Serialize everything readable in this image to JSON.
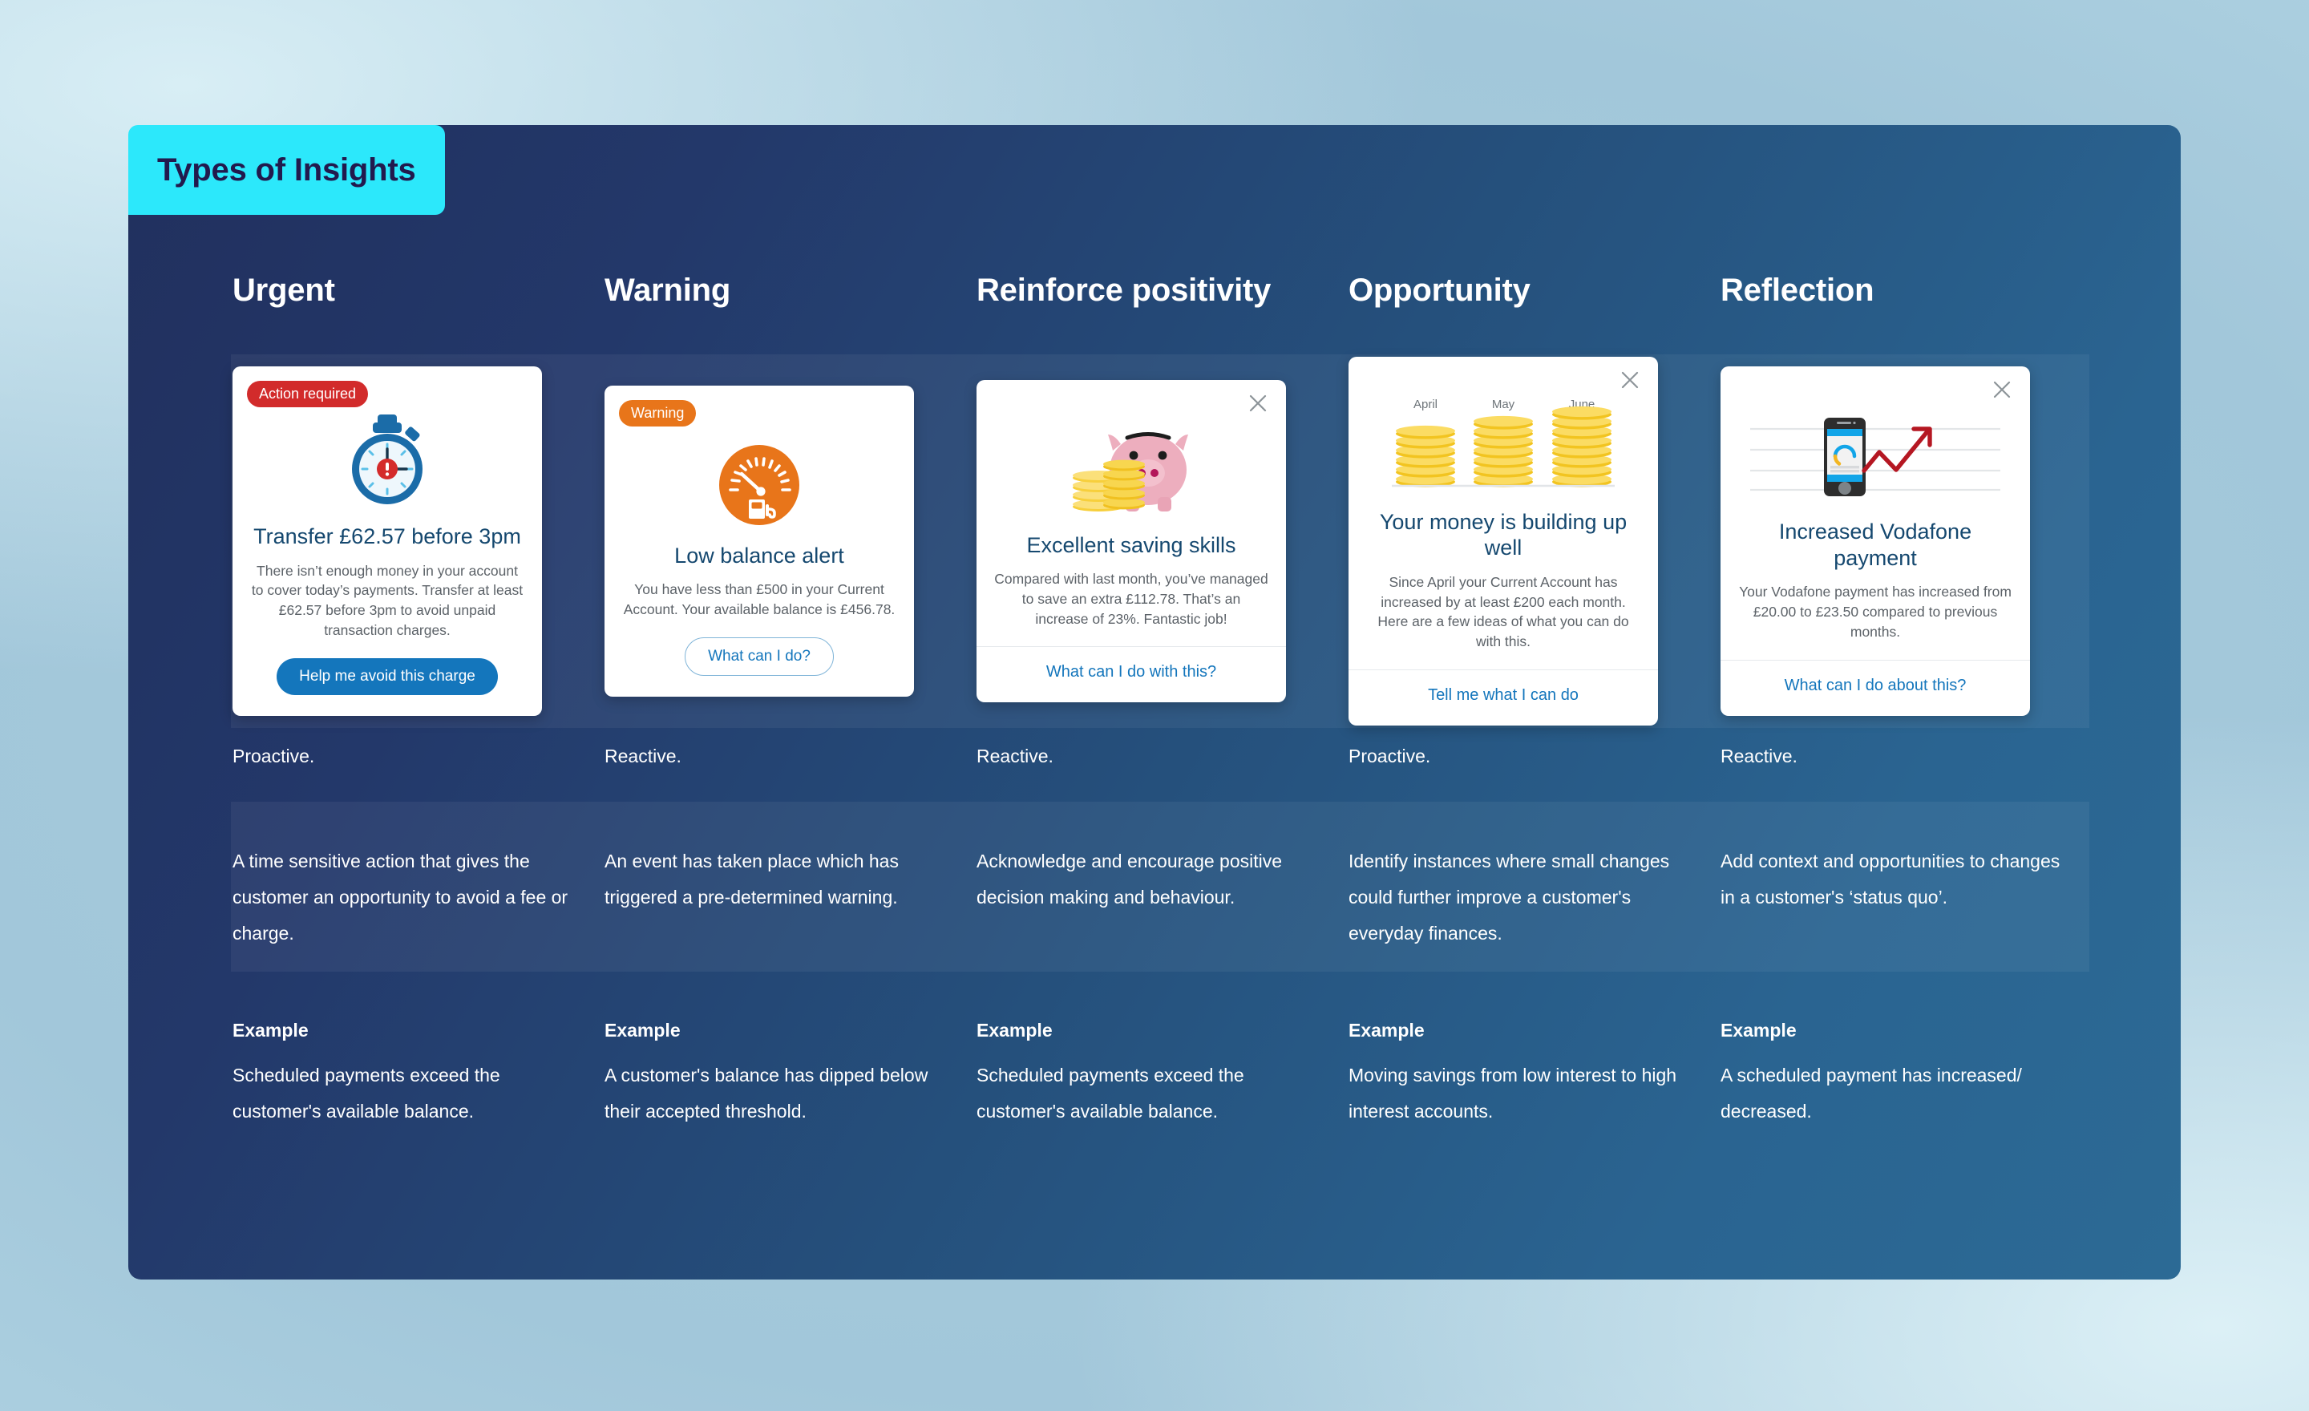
{
  "title_tab": {
    "label": "Types of Insights"
  },
  "theme": {
    "tab_bg": "#2ce8fb",
    "tab_text": "#221a4d",
    "panel_from": "#21305e",
    "panel_to": "#2c6a95",
    "badge_red": "#d22b2b",
    "badge_orange": "#e8751a",
    "link_blue": "#1476bc",
    "card_title": "#15486f"
  },
  "columns": [
    {
      "header": "Urgent",
      "mode": "Proactive.",
      "description": "A time sensitive action that gives the customer an opportunity to avoid a fee or charge.",
      "example_label": "Example",
      "example": "Scheduled payments exceed the customer's available balance.",
      "card": {
        "badge": "Action required",
        "badge_style": "red",
        "has_close": false,
        "icon": "stopwatch-icon",
        "title": "Transfer £62.57 before 3pm",
        "body": "There isn’t enough money in your account to cover today’s payments. Transfer at least £62.57 before 3pm to avoid unpaid transaction charges.",
        "button": "Help me avoid this charge",
        "button_style": "solid"
      }
    },
    {
      "header": "Warning",
      "mode": "Reactive.",
      "description": "An event has taken place which has triggered a pre-determined warning.",
      "example_label": "Example",
      "example": "A customer's balance has dipped below their accepted threshold.",
      "card": {
        "badge": "Warning",
        "badge_style": "orange",
        "has_close": false,
        "icon": "fuel-gauge-icon",
        "title": "Low balance alert",
        "body": "You have less than £500 in your Current Account. Your available balance is £456.78.",
        "button": "What can I do?",
        "button_style": "outline"
      }
    },
    {
      "header": "Reinforce positivity",
      "mode": "Reactive.",
      "description": "Acknowledge and encourage positive decision making and behaviour.",
      "example_label": "Example",
      "example": "Scheduled payments exceed the customer's available balance.",
      "card": {
        "badge": null,
        "badge_style": null,
        "has_close": true,
        "icon": "piggy-bank-icon",
        "title": "Excellent saving skills",
        "body": "Compared with last month, you’ve managed to save an extra £112.78. That’s an increase of 23%. Fantastic job!",
        "footer_link": "What can I do with this?"
      }
    },
    {
      "header": "Opportunity",
      "mode": "Proactive.",
      "description": "Identify instances where small changes could further improve a customer's everyday finances.",
      "example_label": "Example",
      "example": "Moving savings from low interest to high interest accounts.",
      "card": {
        "badge": null,
        "badge_style": null,
        "has_close": true,
        "icon": "coin-stacks-chart-icon",
        "chart_labels": [
          "April",
          "May",
          "June"
        ],
        "chart_coins": [
          6,
          7,
          8
        ],
        "title": "Your money is building up well",
        "body": "Since April your Current Account has increased by at least £200 each month. Here are a few ideas of what you can do with this.",
        "footer_link": "Tell me what I can do"
      }
    },
    {
      "header": "Reflection",
      "mode": "Reactive.",
      "description": "Add context and opportunities to changes in a customer's ‘status quo’.",
      "example_label": "Example",
      "example": "A scheduled payment has increased/ decreased.",
      "card": {
        "badge": null,
        "badge_style": null,
        "has_close": true,
        "icon": "phone-rising-chart-icon",
        "title": "Increased Vodafone payment",
        "body": "Your Vodafone payment has increased from £20.00 to £23.50 compared to previous months.",
        "footer_link": "What can I do about this?"
      }
    }
  ]
}
